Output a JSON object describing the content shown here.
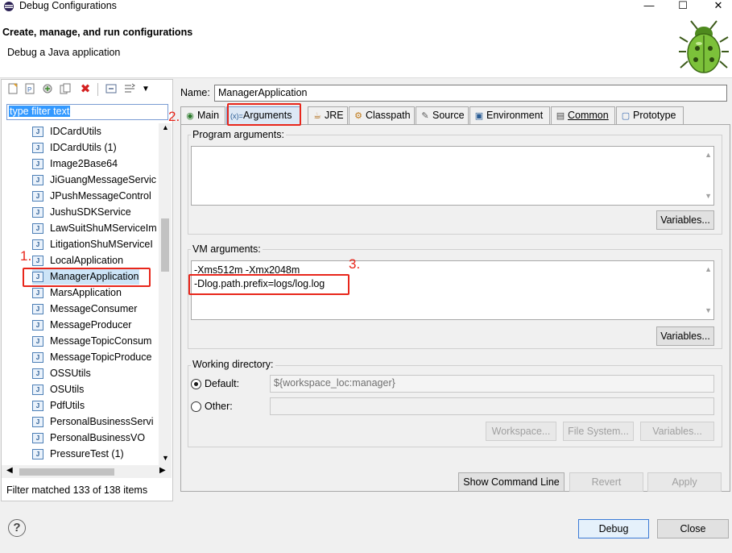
{
  "window": {
    "title": "Debug Configurations",
    "minimize": "—",
    "maximize": "☐",
    "close": "✕"
  },
  "header": {
    "title": "Create, manage, and run configurations",
    "message": "Debug a Java application"
  },
  "left": {
    "toolbar_icons": [
      "new-launch-config-icon",
      "new-prototype-icon",
      "export-icon",
      "duplicate-icon",
      "delete-icon",
      "collapse-all-icon",
      "filter-icon",
      "view-menu-icon"
    ],
    "filter_text": "type filter text",
    "items": [
      "IDCardUtils",
      "IDCardUtils (1)",
      "Image2Base64",
      "JiGuangMessageServic",
      "JPushMessageControl",
      "JushuSDKService",
      "LawSuitShuMServiceIm",
      "LitigationShuMServiceI",
      "LocalApplication",
      "ManagerApplication",
      "MarsApplication",
      "MessageConsumer",
      "MessageProducer",
      "MessageTopicConsum",
      "MessageTopicProduce",
      "OSSUtils",
      "OSUtils",
      "PdfUtils",
      "PersonalBusinessServi",
      "PersonalBusinessVO",
      "PressureTest (1)"
    ],
    "selected_index": 9,
    "status": "Filter matched 133 of 138 items"
  },
  "right": {
    "name_label": "Name:",
    "name_value": "ManagerApplication",
    "tabs": [
      "Main",
      "Arguments",
      "JRE",
      "Classpath",
      "Source",
      "Environment",
      "Common",
      "Prototype"
    ],
    "selected_tab": "Arguments",
    "program_args_label": "Program arguments:",
    "program_args": "",
    "vm_args_label": "VM arguments:",
    "vm_args_line1": "-Xms512m -Xmx2048m",
    "vm_args_line2": "-Dlog.path.prefix=logs/log.log",
    "variables_btn": "Variables...",
    "working_dir_label": "Working directory:",
    "default_label": "Default:",
    "default_value": "${workspace_loc:manager}",
    "other_label": "Other:",
    "other_value": "",
    "workspace_btn": "Workspace...",
    "filesystem_btn": "File System...",
    "variables_btn2": "Variables..."
  },
  "actions": {
    "show_command_line": "Show Command Line",
    "revert": "Revert",
    "apply": "Apply",
    "debug": "Debug",
    "close": "Close"
  },
  "annotations": {
    "step1": "1.",
    "step2": "2.",
    "step3": "3."
  },
  "colors": {
    "annotation_red": "#e8261b",
    "selection_blue": "#3399ff"
  }
}
